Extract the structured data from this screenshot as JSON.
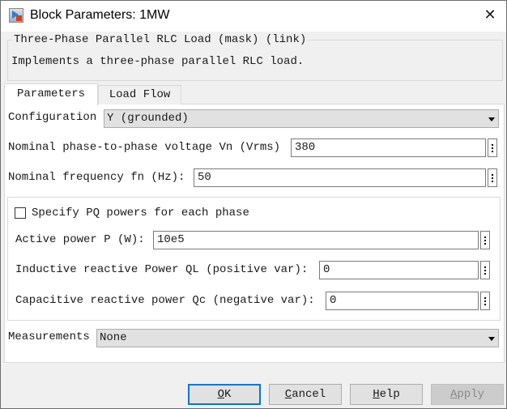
{
  "window": {
    "title": "Block Parameters: 1MW",
    "close_icon": "close-icon"
  },
  "mask": {
    "title": "Three-Phase Parallel RLC Load (mask) (link)",
    "description": "Implements a three-phase parallel RLC load."
  },
  "tabs": [
    {
      "label": "Parameters",
      "active": true
    },
    {
      "label": "Load Flow",
      "active": false
    }
  ],
  "params": {
    "configuration": {
      "label": "Configuration",
      "value": "Y (grounded)"
    },
    "vn": {
      "label": "Nominal phase-to-phase voltage Vn (Vrms)",
      "value": "380"
    },
    "fn": {
      "label": "Nominal frequency fn (Hz):",
      "value": "50"
    },
    "pq": {
      "label": "Specify PQ powers for each phase",
      "checked": false
    },
    "p": {
      "label": "Active power P (W):",
      "value": "10e5"
    },
    "ql": {
      "label": "Inductive reactive Power QL (positive var):",
      "value": "0"
    },
    "qc": {
      "label": "Capacitive reactive power Qc (negative var):",
      "value": "0"
    },
    "measurements": {
      "label": "Measurements",
      "value": "None"
    }
  },
  "buttons": {
    "ok": {
      "u": "O",
      "rest": "K"
    },
    "cancel": {
      "u": "C",
      "rest": "ancel"
    },
    "help": {
      "u": "H",
      "rest": "elp"
    },
    "apply": {
      "u": "A",
      "rest": "pply"
    }
  }
}
